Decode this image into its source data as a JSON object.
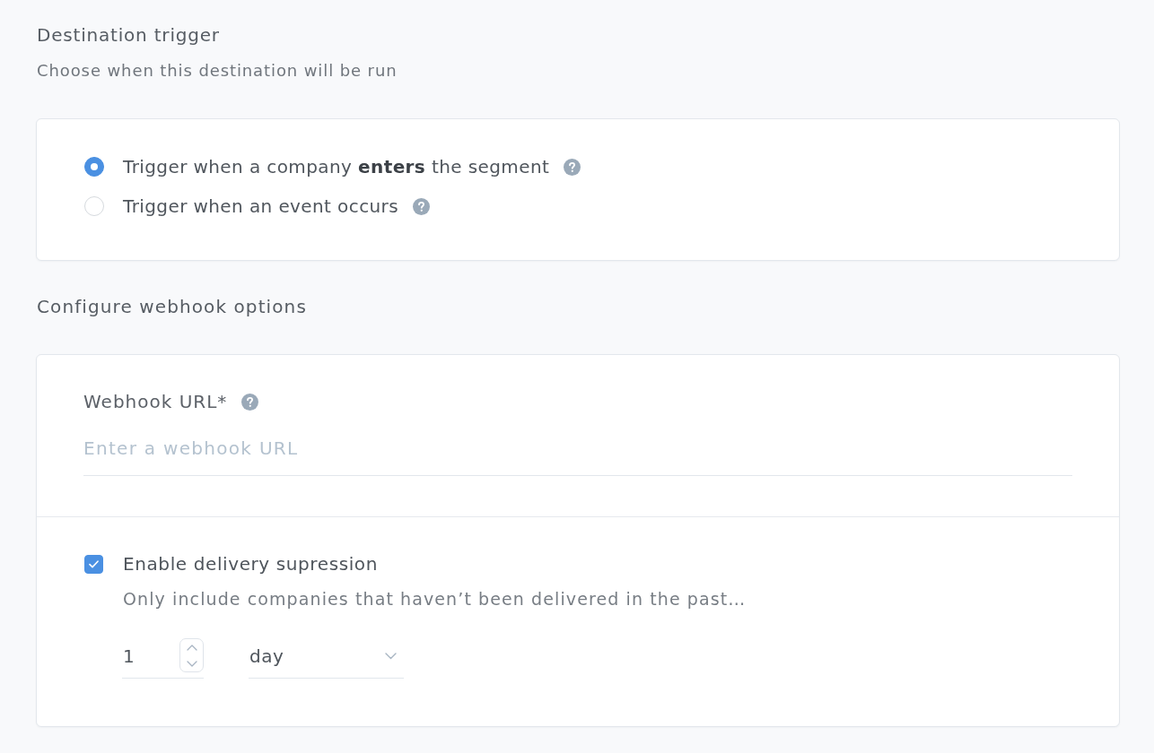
{
  "trigger_section": {
    "title": "Destination trigger",
    "subtitle": "Choose when this destination will be run",
    "options": [
      {
        "label": "Trigger when a company **enters** the segment",
        "selected": true
      },
      {
        "label": "Trigger when an event occurs",
        "selected": false
      }
    ]
  },
  "webhook_section": {
    "title": "Configure webhook options",
    "url_field": {
      "label": "Webhook URL*",
      "placeholder": "Enter a webhook URL"
    },
    "suppression": {
      "label": "Enable delivery supression",
      "checked": true,
      "description": "Only include companies that haven’t been delivered in the past…",
      "amount": "1",
      "unit": "day"
    }
  }
}
